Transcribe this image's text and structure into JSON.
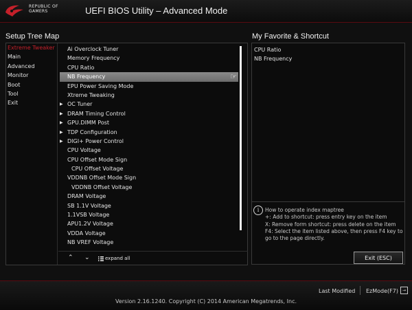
{
  "header": {
    "brand_lines": [
      "REPUBLIC OF",
      "GAMERS"
    ],
    "title": "UEFI BIOS Utility – Advanced Mode"
  },
  "left_panel": {
    "title": "Setup Tree Map",
    "root_menu": [
      {
        "label": "Extreme Tweaker",
        "active": true
      },
      {
        "label": "Main",
        "active": false
      },
      {
        "label": "Advanced",
        "active": false
      },
      {
        "label": "Monitor",
        "active": false
      },
      {
        "label": "Boot",
        "active": false
      },
      {
        "label": "Tool",
        "active": false
      },
      {
        "label": "Exit",
        "active": false
      }
    ],
    "tree_items": [
      {
        "label": "Ai Overclock Tuner",
        "arrow": false,
        "indent": false,
        "selected": false
      },
      {
        "label": "Memory Frequency",
        "arrow": false,
        "indent": false,
        "selected": false
      },
      {
        "label": "CPU Ratio",
        "arrow": false,
        "indent": false,
        "selected": false
      },
      {
        "label": "NB Frequency",
        "arrow": false,
        "indent": false,
        "selected": true
      },
      {
        "label": "EPU Power Saving Mode",
        "arrow": false,
        "indent": false,
        "selected": false
      },
      {
        "label": "Xtreme Tweaking",
        "arrow": false,
        "indent": false,
        "selected": false
      },
      {
        "label": "OC Tuner",
        "arrow": true,
        "indent": false,
        "selected": false
      },
      {
        "label": "DRAM Timing Control",
        "arrow": true,
        "indent": false,
        "selected": false
      },
      {
        "label": "GPU.DIMM Post",
        "arrow": true,
        "indent": false,
        "selected": false
      },
      {
        "label": "TDP Configuration",
        "arrow": true,
        "indent": false,
        "selected": false
      },
      {
        "label": "DIGI+ Power Control",
        "arrow": true,
        "indent": false,
        "selected": false
      },
      {
        "label": "CPU Voltage",
        "arrow": false,
        "indent": false,
        "selected": false
      },
      {
        "label": "CPU Offset Mode Sign",
        "arrow": false,
        "indent": false,
        "selected": false
      },
      {
        "label": "CPU Offset Voltage",
        "arrow": false,
        "indent": true,
        "selected": false
      },
      {
        "label": "VDDNB Offset Mode Sign",
        "arrow": false,
        "indent": false,
        "selected": false
      },
      {
        "label": "VDDNB Offset Voltage",
        "arrow": false,
        "indent": true,
        "selected": false
      },
      {
        "label": "DRAM Voltage",
        "arrow": false,
        "indent": false,
        "selected": false
      },
      {
        "label": "SB 1.1V Voltage",
        "arrow": false,
        "indent": false,
        "selected": false
      },
      {
        "label": "1.1VSB Voltage",
        "arrow": false,
        "indent": false,
        "selected": false
      },
      {
        "label": "APU1.2V Voltage",
        "arrow": false,
        "indent": false,
        "selected": false
      },
      {
        "label": "VDDA Voltage",
        "arrow": false,
        "indent": false,
        "selected": false
      },
      {
        "label": "NB VREF Voltage",
        "arrow": false,
        "indent": false,
        "selected": false
      }
    ],
    "footer": {
      "collapse_glyph": "⌃",
      "expand_glyph": "⌄",
      "expand_all_label": "expand all"
    }
  },
  "right_panel": {
    "title": "My Favorite & Shortcut",
    "favorites": [
      "CPU Ratio",
      "NB Frequency"
    ],
    "help_lines": [
      "How to operate index maptree",
      "+: Add to shortcut: press entry key on the item",
      "X: Remove form shortcut: press delete on the item",
      "F4: Select the item listed above, then press F4 key to go to the page directly."
    ],
    "exit_label": "Exit (ESC)"
  },
  "bottom_bar": {
    "last_modified": "Last Modified",
    "ezmode": "EzMode(F7)",
    "version": "Version 2.16.1240. Copyright (C) 2014 American Megatrends, Inc."
  },
  "colors": {
    "accent_red": "#c4202a",
    "selected_bg": "#7a7a7a"
  }
}
